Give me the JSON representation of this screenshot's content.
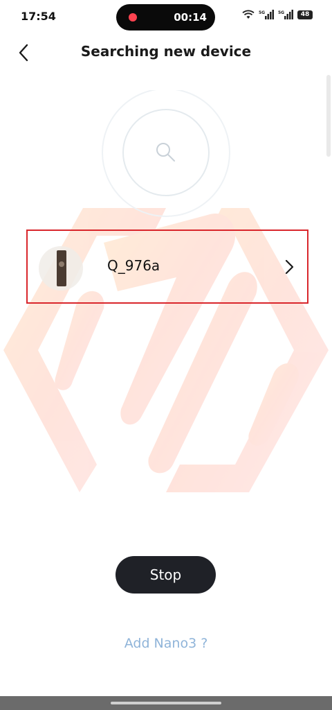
{
  "status_bar": {
    "time": "17:54",
    "recording_time": "00:14",
    "battery": "48",
    "icons": [
      "wifi-icon",
      "signal-5g-icon",
      "signal-5g-icon",
      "battery-icon"
    ]
  },
  "header": {
    "title": "Searching new device",
    "back_icon": "chevron-left-icon"
  },
  "radar": {
    "icon": "search-icon"
  },
  "device": {
    "name": "Q_976a",
    "arrow_icon": "chevron-right-icon"
  },
  "actions": {
    "stop_label": "Stop",
    "add_link": "Add Nano3 ?"
  },
  "colors": {
    "highlight_border": "#d9262b",
    "stop_button_bg": "#1f2127",
    "link_color": "#8fb4d9"
  }
}
